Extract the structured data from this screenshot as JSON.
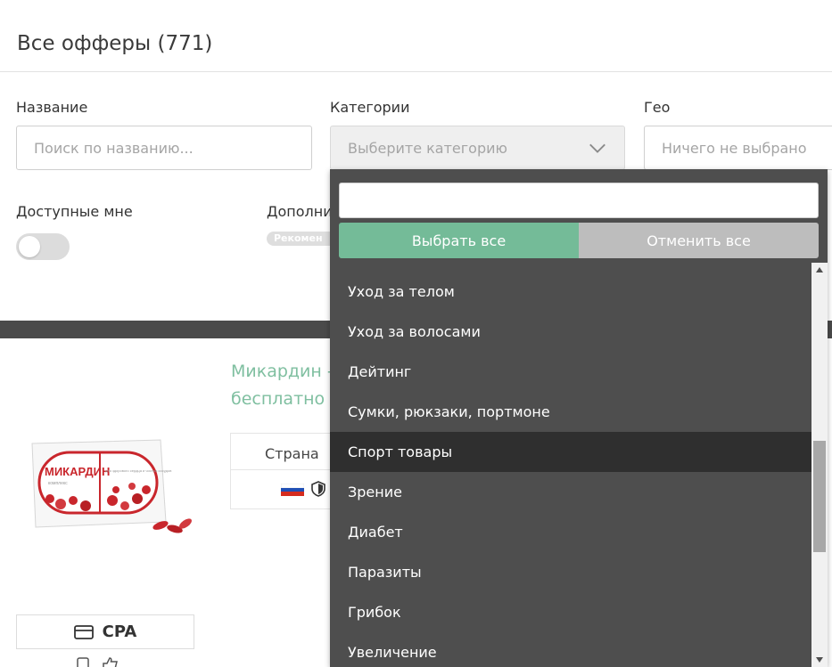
{
  "page": {
    "title": "Все офферы (771)"
  },
  "filters": {
    "name": {
      "label": "Название",
      "placeholder": "Поиск по названию..."
    },
    "categories": {
      "label": "Категории",
      "placeholder": "Выберите категорию"
    },
    "geo": {
      "label": "Гео",
      "placeholder": "Ничего не выбрано"
    },
    "available": {
      "label": "Доступные мне",
      "enabled": false
    },
    "extra": {
      "label": "Дополни",
      "chip": "Рекомен"
    }
  },
  "offer": {
    "title_line1": "Микардин -",
    "title_line2": "бесплатно",
    "table_header": "Страна",
    "product_brand": "МИКАРДИН",
    "product_subtitle": "комплекс",
    "product_desc": "для здорового сердца и чистых сосудов",
    "cpa_label": "CPA"
  },
  "dropdown": {
    "search_value": "",
    "select_all": "Выбрать все",
    "cancel_all": "Отменить все",
    "items": [
      {
        "label": "Уход за телом"
      },
      {
        "label": "Уход за волосами"
      },
      {
        "label": "Дейтинг"
      },
      {
        "label": "Сумки, рюкзаки, портмоне"
      },
      {
        "label": "Спорт товары",
        "highlighted": true
      },
      {
        "label": "Зрение"
      },
      {
        "label": "Диабет"
      },
      {
        "label": "Паразиты"
      },
      {
        "label": "Грибок"
      },
      {
        "label": "Увеличение"
      }
    ]
  },
  "colors": {
    "accent_green": "#74bb98",
    "offer_title_green": "#7fbfa0",
    "dropdown_bg": "#4e4e4e",
    "dropdown_active": "#2f2f2f",
    "dark_band": "#4a4a4a"
  },
  "icons": {
    "chevron": "chevron-down-icon",
    "flag": "russia-flag-icon",
    "shield": "shield-icon",
    "card": "credit-card-icon",
    "checkbox": "checkbox-icon",
    "thumb": "thumbs-up-icon"
  }
}
